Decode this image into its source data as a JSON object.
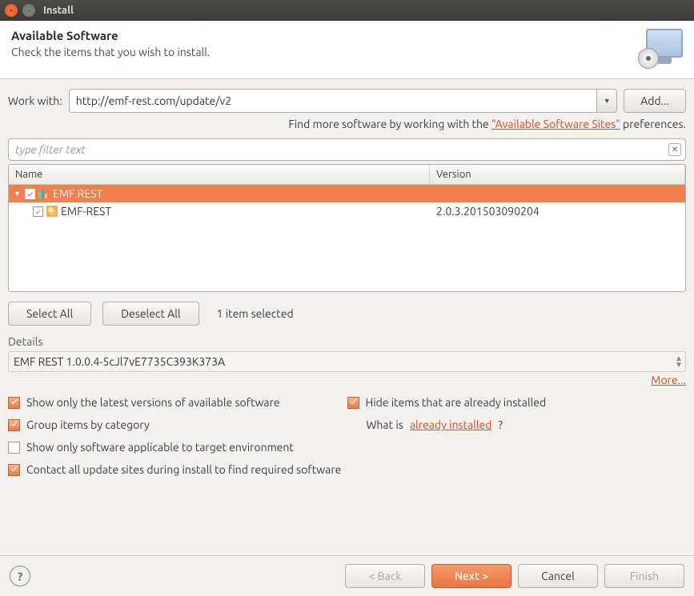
{
  "window": {
    "title": "Install"
  },
  "header": {
    "title": "Available Software",
    "subtitle": "Check the items that you wish to install."
  },
  "work_with": {
    "label": "Work with:",
    "value": "http://emf-rest.com/update/v2",
    "add_btn": "Add..."
  },
  "help_line": {
    "prefix": "Find more software by working with the ",
    "link": "\"Available Software Sites\"",
    "suffix": " preferences."
  },
  "filter": {
    "placeholder": "type filter text"
  },
  "columns": {
    "name": "Name",
    "version": "Version"
  },
  "tree": {
    "category": {
      "label": "EMF REST",
      "checked": true,
      "expanded": true
    },
    "feature": {
      "label": "EMF-REST",
      "version": "2.0.3.201503090204",
      "checked": true
    }
  },
  "selection": {
    "select_all": "Select All",
    "deselect_all": "Deselect All",
    "count_text": "1 item selected"
  },
  "details": {
    "label": "Details",
    "value": "EMF REST 1.0.0.4-5cJl7vE7735C393K373A",
    "more": "More..."
  },
  "options": {
    "latest": "Show only the latest versions of available software",
    "hide_installed": "Hide items that are already installed",
    "group": "Group items by category",
    "what_prefix": "What is ",
    "what_link": "already installed",
    "what_suffix": "?",
    "target_env": "Show only software applicable to target environment",
    "contact_sites": "Contact all update sites during install to find required software"
  },
  "buttons": {
    "back": "< Back",
    "next": "Next >",
    "cancel": "Cancel",
    "finish": "Finish"
  }
}
